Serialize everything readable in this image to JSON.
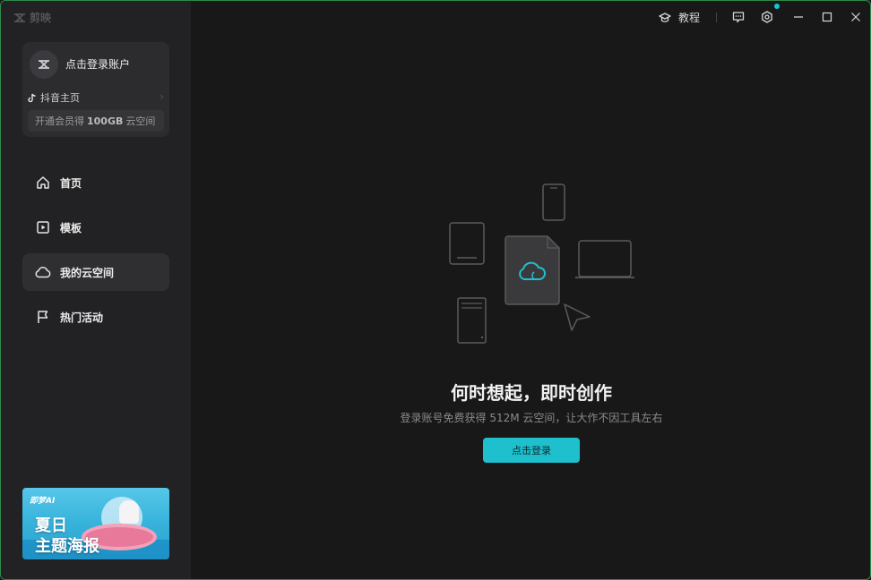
{
  "app": {
    "name": "剪映",
    "title_bar": {
      "tutorial_label": "教程"
    }
  },
  "account": {
    "login_label": "点击登录账户",
    "douyin_label": "抖音主页",
    "vip_prefix": "开通会员得",
    "vip_amount": "100GB",
    "vip_suffix": "云空间"
  },
  "sidebar": {
    "items": [
      {
        "label": "首页",
        "icon": "home-icon",
        "active": false
      },
      {
        "label": "模板",
        "icon": "template-icon",
        "active": false
      },
      {
        "label": "我的云空间",
        "icon": "cloud-icon",
        "active": true
      },
      {
        "label": "热门活动",
        "icon": "flag-icon",
        "active": false
      }
    ]
  },
  "promo": {
    "brand": "即梦AI",
    "line1": "夏日",
    "line2": "主题海报"
  },
  "main": {
    "headline": "何时想起，即时创作",
    "subline": "登录账号免费获得 512M 云空间，让大作不因工具左右",
    "login_button": "点击登录"
  },
  "colors": {
    "accent": "#1ec0ce",
    "background": "#181818",
    "sidebar": "#222224"
  }
}
